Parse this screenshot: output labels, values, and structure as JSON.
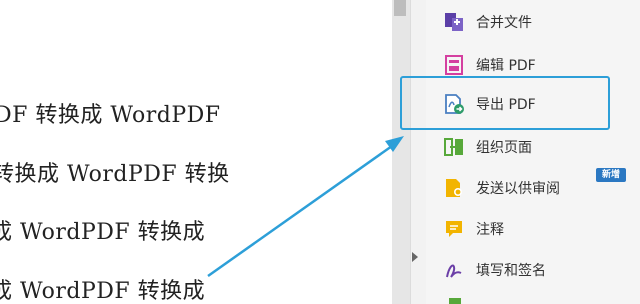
{
  "document": {
    "lines": [
      "DF 转换成 WordPDF",
      "转换成 WordPDF 转换",
      "成 WordPDF 转换成",
      "成 WordPDF 转换成"
    ]
  },
  "tools_panel": {
    "items": [
      {
        "label": "合并文件",
        "icon": "combine-files-icon"
      },
      {
        "label": "编辑 PDF",
        "icon": "edit-pdf-icon"
      },
      {
        "label": "导出 PDF",
        "icon": "export-pdf-icon"
      },
      {
        "label": "组织页面",
        "icon": "organize-pages-icon"
      },
      {
        "label": "发送以供审阅",
        "icon": "send-for-review-icon"
      },
      {
        "label": "注释",
        "icon": "comment-icon"
      },
      {
        "label": "填写和签名",
        "icon": "fill-sign-icon"
      }
    ],
    "new_badge": "新增",
    "highlighted_item": "导出 PDF"
  },
  "colors": {
    "highlight": "#2d9fd8",
    "arrow": "#2d9fd8",
    "badge": "#2b78c2"
  }
}
